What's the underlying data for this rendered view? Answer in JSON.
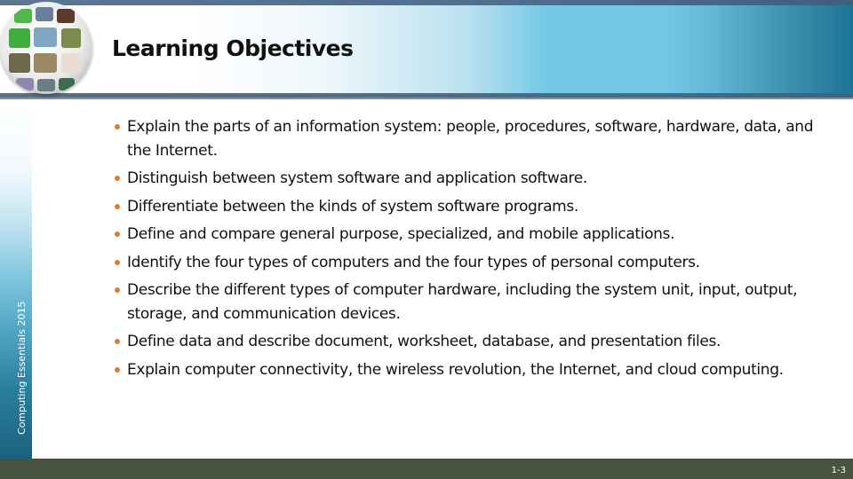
{
  "header": {
    "title": "Learning Objectives",
    "logo_icon": "globe-photo-mosaic-icon"
  },
  "sidebar": {
    "label": "Computing Essentials 2015"
  },
  "objectives": [
    {
      "text": "Explain the parts of an information system: people, procedures, software, hardware, data, and the Internet."
    },
    {
      "text": "Distinguish between system software and application software."
    },
    {
      "text": "Differentiate between the kinds of system software programs."
    },
    {
      "text": "Define and compare general purpose, specialized, and mobile applications."
    },
    {
      "text": "Identify the four types of computers and the four types of personal computers."
    },
    {
      "text": "Describe the different types of computer hardware, including the system unit, input, output, storage, and communication devices."
    },
    {
      "text": "Define data and describe document, worksheet, database, and presentation files."
    },
    {
      "text": "Explain computer connectivity, the wireless revolution, the Internet, and cloud computing."
    }
  ],
  "footer": {
    "page_number": "1-3"
  },
  "colors": {
    "bullet": "#e07b32",
    "header_accent": "#72c8e5",
    "footer": "#48543d",
    "sidebar_dark": "#1b617f"
  }
}
